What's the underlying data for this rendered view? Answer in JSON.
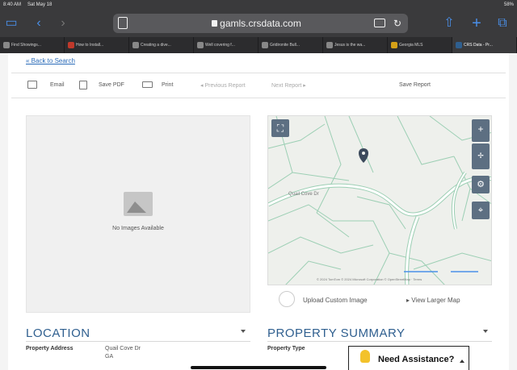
{
  "status": {
    "time": "8:40 AM",
    "date": "Sat May 18",
    "battery": "58%"
  },
  "browser": {
    "url": "gamls.crsdata.com",
    "tabs": [
      {
        "label": "Find Showings..."
      },
      {
        "label": "How to Install..."
      },
      {
        "label": "Creating a dive..."
      },
      {
        "label": "Well covering f..."
      },
      {
        "label": "Gridironite Bull..."
      },
      {
        "label": "Jesus is the wa..."
      },
      {
        "label": "Georgia MLS"
      },
      {
        "label": "CRS Data - Pr..."
      }
    ]
  },
  "page": {
    "back_link": "« Back to Search",
    "actions": {
      "email": "Email",
      "save_pdf": "Save PDF",
      "print": "Print",
      "previous_report": "◂ Previous Report",
      "next_report": "Next Report ▸",
      "save_report": "Save Report"
    },
    "photo": {
      "no_images_text": "No Images Available"
    },
    "map": {
      "road_label": "Quail Cove Dr",
      "attribution": "© 2024 TomTom © 2024 Microsoft Corporation © OpenStreetMap · Terms",
      "upload_custom_image": "Upload Custom Image",
      "view_larger_map": "▸ View Larger Map"
    },
    "location": {
      "title": "LOCATION",
      "property_address_label": "Property Address",
      "address_line1": "Quail Cove Dr",
      "address_line2": "GA"
    },
    "property_summary": {
      "title": "PROPERTY SUMMARY",
      "property_type_label": "Property Type"
    },
    "assistance": {
      "label": "Need Assistance?"
    }
  },
  "colors": {
    "link": "#2a6bb8",
    "section_title": "#2f5f8f",
    "map_button": "#5d6f82",
    "assist_icon": "#f3c22b"
  }
}
